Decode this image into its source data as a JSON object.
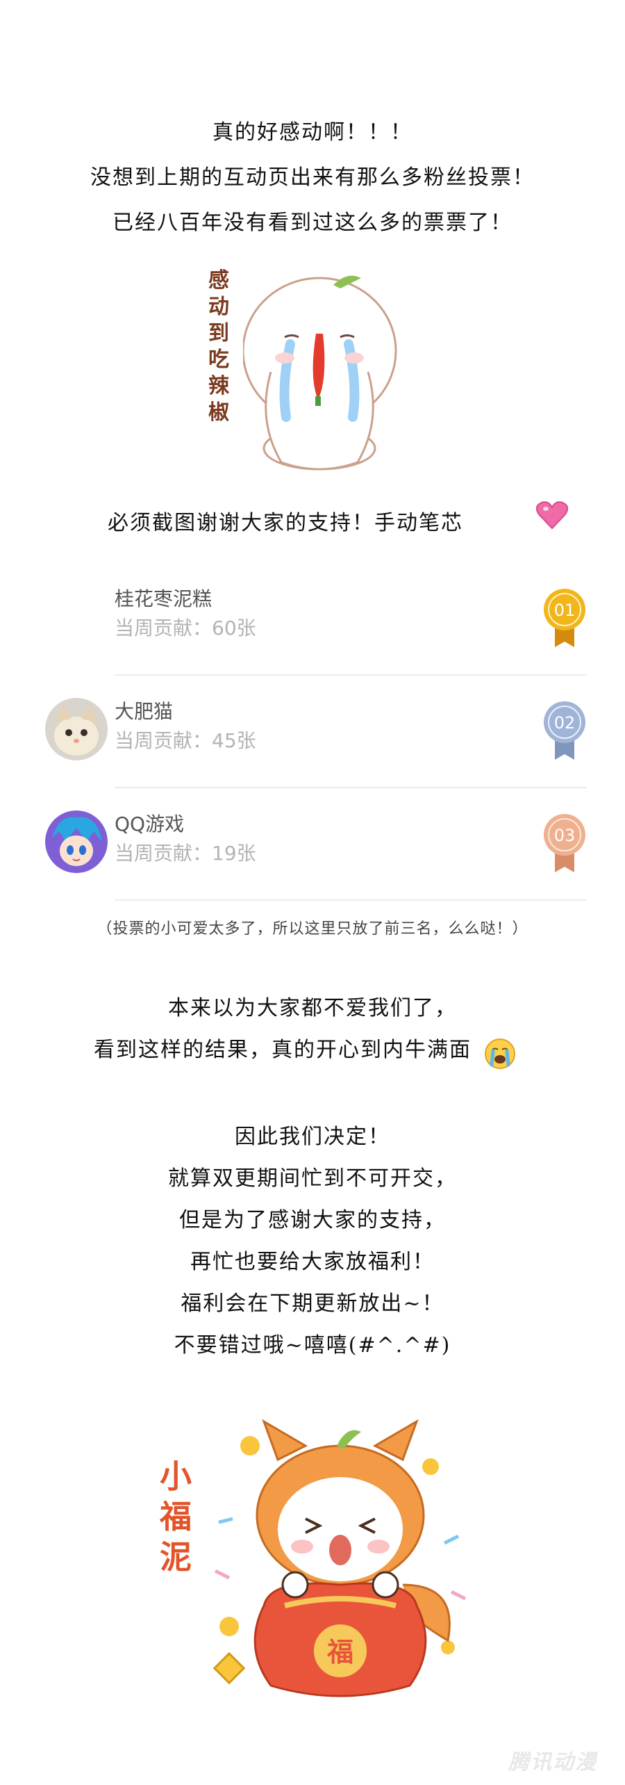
{
  "intro": {
    "line1": "真的好感动啊！！！",
    "line2": "没想到上期的互动页出来有那么多粉丝投票！",
    "line3": "已经八百年没有看到过这么多的票票了！"
  },
  "sticker1": {
    "caption": "感动到吃辣椒"
  },
  "thanks": {
    "text": "必须截图谢谢大家的支持！手动笔芯",
    "emoji": "heart-icon"
  },
  "ranking": [
    {
      "name": "桂花枣泥糕",
      "contribution": "当周贡献：60张",
      "medal": "01",
      "medal_color": "#f2b61b"
    },
    {
      "name": "大肥猫",
      "contribution": "当周贡献：45张",
      "medal": "02",
      "medal_color": "#9fb4d6"
    },
    {
      "name": "QQ游戏",
      "contribution": "当周贡献：19张",
      "medal": "03",
      "medal_color": "#eeb08e"
    }
  ],
  "note": "（投票的小可爱太多了，所以这里只放了前三名，么么哒！）",
  "paragraph1": {
    "line1": "本来以为大家都不爱我们了，",
    "line2": "看到这样的结果，真的开心到内牛满面"
  },
  "paragraph2": {
    "lines": [
      "因此我们决定！",
      "就算双更期间忙到不可开交，",
      "但是为了感谢大家的支持，",
      "再忙也要给大家放福利！",
      "福利会在下期更新放出~！",
      "不要错过哦~嘻嘻(#^.^#)"
    ]
  },
  "sticker2": {
    "caption": "小福泥",
    "bag_text": "福"
  },
  "watermark": "腾讯动漫",
  "colors": {
    "accent_red": "#e2552b",
    "gold": "#f2b61b",
    "silver": "#9fb4d6",
    "bronze": "#eeb08e"
  }
}
